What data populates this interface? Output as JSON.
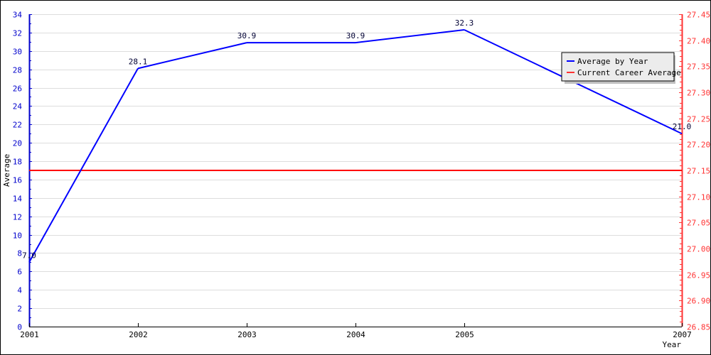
{
  "chart_data": {
    "type": "line",
    "title": "",
    "xlabel": "Year",
    "ylabel": "Average",
    "x": [
      "2001",
      "2002",
      "2003",
      "2004",
      "2005",
      "2007"
    ],
    "series": [
      {
        "name": "Average by Year",
        "color": "#0000ff",
        "axis": "left",
        "values": [
          7.0,
          28.1,
          30.9,
          30.9,
          32.3,
          21.0
        ],
        "labels": [
          "7.0",
          "28.1",
          "30.9",
          "30.9",
          "32.3",
          "21.0"
        ]
      },
      {
        "name": "Current Career Average",
        "color": "#ff0000",
        "axis": "right",
        "value": 27.15
      }
    ],
    "y_left": {
      "range": [
        0,
        34
      ],
      "ticks": [
        "0",
        "2",
        "4",
        "6",
        "8",
        "10",
        "12",
        "14",
        "16",
        "18",
        "20",
        "22",
        "24",
        "26",
        "28",
        "30",
        "32",
        "34"
      ],
      "color": "#0000cc"
    },
    "y_right": {
      "range": [
        26.85,
        27.45
      ],
      "ticks": [
        "26.85",
        "26.90",
        "26.95",
        "27.00",
        "27.05",
        "27.10",
        "27.15",
        "27.20",
        "27.25",
        "27.30",
        "27.35",
        "27.40",
        "27.45"
      ],
      "color": "#ff3333"
    },
    "grid": true,
    "legend": {
      "position": "top-right",
      "entries": [
        "Average by Year",
        "Current Career Average"
      ]
    }
  }
}
